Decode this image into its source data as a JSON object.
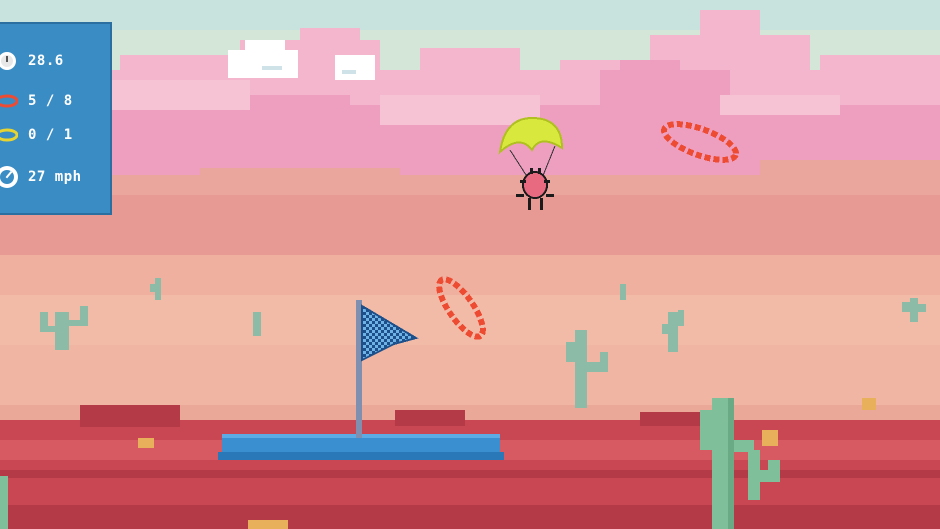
{
  "hud": {
    "time": "28.6",
    "red_rings": "5 / 8",
    "gold_rings": "0 / 1",
    "speed": "27 mph"
  },
  "icons": {
    "time": "stopwatch-icon",
    "red_rings": "red-ring-icon",
    "gold_rings": "gold-ring-icon",
    "speed": "speedometer-icon"
  },
  "colors": {
    "sky_top": "#d4e8dc",
    "cloud_pink": "#f2a9c8",
    "ground_red": "#c94a55",
    "cactus_green": "#7fbf9a",
    "ring_red": "#ee4b33",
    "parachute_yellow": "#d8e83c",
    "platform_blue": "#3a8fd0",
    "flag_blue": "#2e6fb0",
    "hud_bg": "#3a8cc4"
  }
}
